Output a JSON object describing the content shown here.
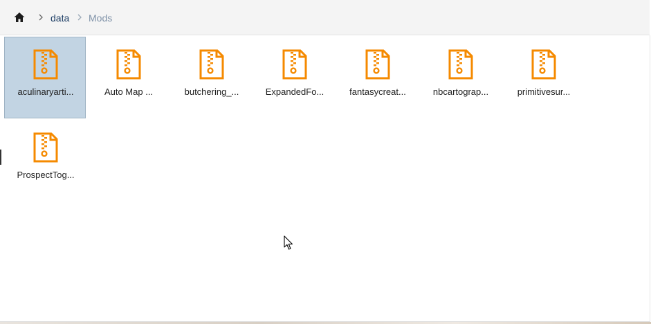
{
  "breadcrumb": {
    "home_icon": "home-icon",
    "separator_icon": "chevron-right-icon",
    "items": [
      {
        "label": "data",
        "current": false
      },
      {
        "label": "Mods",
        "current": true
      }
    ]
  },
  "file_icon": "zip-file-icon",
  "colors": {
    "accent_file_icon": "#f58a00",
    "selection_background": "#c2d4e3",
    "breadcrumb_link": "#1f3f66",
    "breadcrumb_current": "#7f92a8"
  },
  "files": [
    {
      "name": "aculinaryarti...",
      "selected": true
    },
    {
      "name": "Auto Map ...",
      "selected": false
    },
    {
      "name": "butchering_...",
      "selected": false
    },
    {
      "name": "ExpandedFo...",
      "selected": false
    },
    {
      "name": "fantasycreat...",
      "selected": false
    },
    {
      "name": "nbcartograp...",
      "selected": false
    },
    {
      "name": "primitivesur...",
      "selected": false
    },
    {
      "name": "ProspectTog...",
      "selected": false
    }
  ]
}
